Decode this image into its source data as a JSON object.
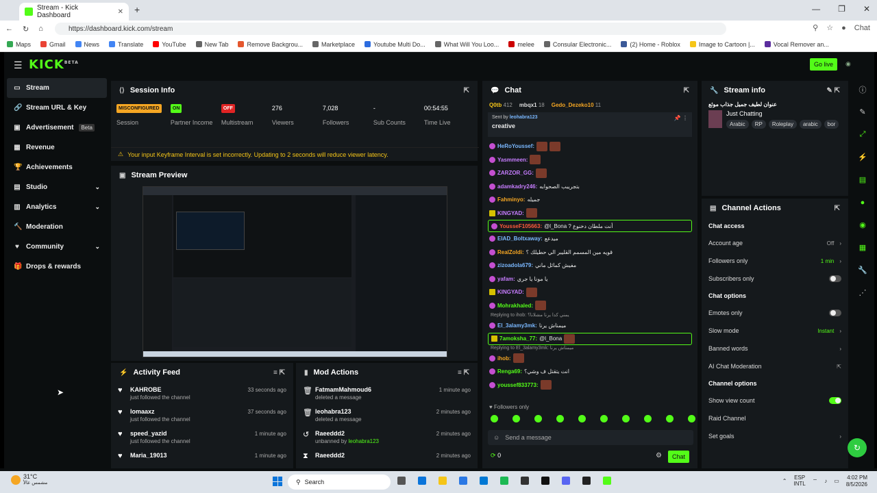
{
  "browser": {
    "tab_title": "Stream - Kick Dashboard",
    "url": "https://dashboard.kick.com/stream",
    "chat_label": "Chat",
    "bookmarks": [
      "Maps",
      "Gmail",
      "News",
      "Translate",
      "YouTube",
      "New Tab",
      "Remove Backgrou...",
      "Marketplace",
      "Youtube Multi Do...",
      "What Will You Loo...",
      "melee",
      "Consular Electronic...",
      "(2) Home - Roblox",
      "Image to Cartoon |...",
      "Vocal Remover an..."
    ]
  },
  "topnav": {
    "logo": "KICK",
    "logo_beta": "BETA",
    "go_live": "Go live"
  },
  "sidebar": {
    "items": [
      {
        "label": "Stream",
        "icon": "stream-icon"
      },
      {
        "label": "Stream URL & Key",
        "icon": "link-icon"
      },
      {
        "label": "Advertisement",
        "icon": "ad-icon",
        "badge": "Beta"
      },
      {
        "label": "Revenue",
        "icon": "revenue-icon"
      },
      {
        "label": "Achievements",
        "icon": "trophy-icon"
      },
      {
        "label": "Studio",
        "icon": "studio-icon"
      },
      {
        "label": "Analytics",
        "icon": "analytics-icon"
      },
      {
        "label": "Moderation",
        "icon": "moderation-icon"
      },
      {
        "label": "Community",
        "icon": "community-icon"
      },
      {
        "label": "Drops & rewards",
        "icon": "gift-icon"
      }
    ]
  },
  "session": {
    "title": "Session Info",
    "stats": [
      {
        "value": "MISCONFIGURED",
        "label": "Session",
        "kind": "orange"
      },
      {
        "value": "ON",
        "label": "Partner Income",
        "kind": "green"
      },
      {
        "value": "OFF",
        "label": "Multistream",
        "kind": "red"
      },
      {
        "value": "276",
        "label": "Viewers",
        "kind": "text"
      },
      {
        "value": "7,028",
        "label": "Followers",
        "kind": "text"
      },
      {
        "value": "-",
        "label": "Sub Counts",
        "kind": "text"
      },
      {
        "value": "00:54:55",
        "label": "Time Live",
        "kind": "text"
      }
    ],
    "warning": "Your input Keyframe Interval is set incorrectly. Updating to 2 seconds will reduce viewer latency."
  },
  "preview": {
    "title": "Stream Preview"
  },
  "activity": {
    "title": "Activity Feed",
    "rows": [
      {
        "name": "KAHROBE",
        "sub": "just followed the channel",
        "time": "33 seconds ago"
      },
      {
        "name": "lomaaxz",
        "sub": "just followed the channel",
        "time": "37 seconds ago"
      },
      {
        "name": "speed_yazid",
        "sub": "just followed the channel",
        "time": "1 minute ago"
      },
      {
        "name": "Maria_19013",
        "sub": "",
        "time": "1 minute ago"
      }
    ]
  },
  "mod": {
    "title": "Mod Actions",
    "rows": [
      {
        "name": "FatmamMahmoud6",
        "sub": "deleted a message",
        "time": "1 minute ago",
        "icon": "trash-icon"
      },
      {
        "name": "leohabra123",
        "sub": "deleted a message",
        "time": "2 minutes ago",
        "icon": "trash-icon"
      },
      {
        "name": "Raeeddd2",
        "sub": "unbanned by",
        "sub2": "leohabra123",
        "time": "2 minutes ago",
        "icon": "unban-icon"
      },
      {
        "name": "Raeeddd2",
        "sub": "",
        "time": "2 minutes ago",
        "icon": "timeout-icon"
      }
    ]
  },
  "chat": {
    "title": "Chat",
    "top": [
      {
        "name": "Q0tb",
        "count": "412"
      },
      {
        "name": "mbqx1",
        "count": "18"
      },
      {
        "name": "Gedo_Dezeko10",
        "count": "11"
      }
    ],
    "pinned_by": "Sent by",
    "pinned_user": "leohabra123",
    "pinned_msg": "creative",
    "messages": [
      {
        "user": "HeRoYoussef:",
        "color": "#7ab8ff",
        "text": "",
        "emotes": 2
      },
      {
        "user": "Yasmmeen:",
        "color": "#c77dff",
        "text": "",
        "emotes": 1
      },
      {
        "user": "ZARZOR_GG:",
        "color": "#c77dff",
        "text": "",
        "emotes": 1
      },
      {
        "user": "adamkadry246:",
        "color": "#c77dff",
        "text": "بتجريبب الصحوابه",
        "emotes": 0
      },
      {
        "user": "Fahminyo:",
        "color": "#f5a623",
        "text": "جميله",
        "emotes": 0
      },
      {
        "user": "KINGYAD:",
        "color": "#c77dff",
        "text": "",
        "emotes": 1,
        "yb": true
      },
      {
        "user": "YousseF105663:",
        "color": "#ff5a3c",
        "text": "@l_Bona ? أنت ملطان دخنوع",
        "emotes": 0,
        "hl": true
      },
      {
        "user": "EIAD_Boltxaway:",
        "color": "#7ab8ff",
        "text": "ميدعع",
        "emotes": 0
      },
      {
        "user": "RealZoldi:",
        "color": "#f5a623",
        "text": "قويه مين المسمم القليبر الي حطيلك ؟",
        "emotes": 0
      },
      {
        "user": "zizoadola679:",
        "color": "#7ab8ff",
        "text": "مفيش كمائل ماني",
        "emotes": 0
      },
      {
        "user": "yafam:",
        "color": "#c77dff",
        "text": "يا مونا يا جري",
        "emotes": 0
      },
      {
        "user": "KINGYAD:",
        "color": "#c77dff",
        "text": "",
        "emotes": 1,
        "yb": true
      },
      {
        "user": "Mohrakhaled:",
        "color": "#53fc18",
        "text": "",
        "emotes": 1
      },
      {
        "reply": "Replying to ihob: يمني كدا يرنا مشلانا؟"
      },
      {
        "user": "El_3alamy3mk:",
        "color": "#7ab8ff",
        "text": "ميمناش يرنا",
        "emotes": 0
      },
      {
        "user": "7amoksha_77:",
        "color": "#53fc18",
        "text": "@l_Bona",
        "emotes": 1,
        "hl": true,
        "yb": true
      },
      {
        "reply": "Replying to El_3alamy3mk: ميمناش يرنا"
      },
      {
        "user": "ihob:",
        "color": "#f5a623",
        "text": "",
        "emotes": 1
      },
      {
        "user": "Renga69:",
        "color": "#53fc18",
        "text": "انت يتقتل ف وشي؟",
        "emotes": 0
      },
      {
        "user": "youssef833773:",
        "color": "#53fc18",
        "text": "",
        "emotes": 1
      }
    ],
    "followers_only": "Followers only",
    "input_placeholder": "Send a message",
    "count": "0",
    "send": "Chat"
  },
  "stream_info": {
    "title": "Stream info",
    "stream_title": "عنوان لطيف جميل جذاب موثع",
    "category": "Just Chatting",
    "tags": [
      "Arabic",
      "RP",
      "Roleplay",
      "arabic",
      "bor"
    ]
  },
  "channel_actions": {
    "title": "Channel Actions",
    "sections": [
      {
        "heading": "Chat access",
        "rows": [
          {
            "label": "Account age",
            "value": "Off",
            "type": "arrow"
          },
          {
            "label": "Followers only",
            "value": "1 min",
            "type": "arrow-green"
          },
          {
            "label": "Subscribers only",
            "value": "",
            "type": "toggle-off"
          }
        ]
      },
      {
        "heading": "Chat options",
        "rows": [
          {
            "label": "Emotes only",
            "value": "",
            "type": "toggle-off"
          },
          {
            "label": "Slow mode",
            "value": "Instant",
            "type": "arrow-green"
          },
          {
            "label": "Banned words",
            "value": "",
            "type": "arrow"
          },
          {
            "label": "AI Chat Moderation",
            "value": "",
            "type": "ext"
          }
        ]
      },
      {
        "heading": "Channel options",
        "rows": [
          {
            "label": "Show view count",
            "value": "",
            "type": "toggle-on"
          },
          {
            "label": "Raid Channel",
            "value": "",
            "type": "none"
          },
          {
            "label": "Set goals",
            "value": "",
            "type": "arrow"
          }
        ]
      }
    ]
  },
  "taskbar": {
    "temp": "31°C",
    "weather": "مشمس عالأ",
    "search": "Search",
    "lang1": "ESP",
    "lang2": "INTL",
    "time": "4:02 PM",
    "date": "8/5/2026"
  }
}
